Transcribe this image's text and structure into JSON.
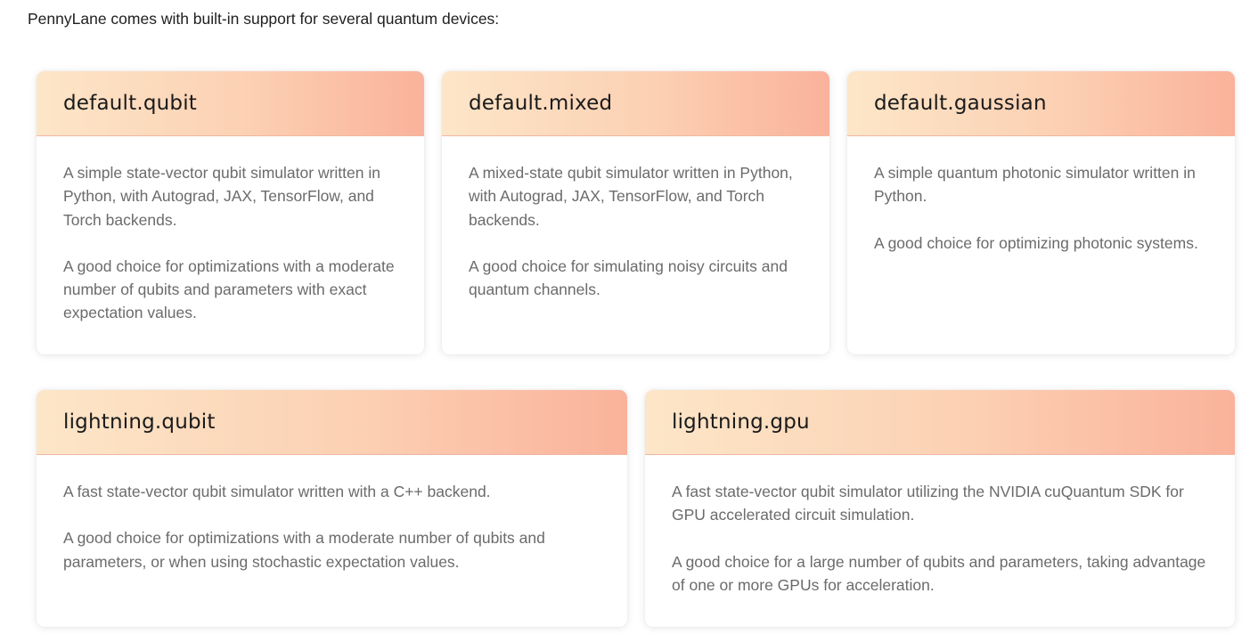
{
  "intro": "PennyLane comes with built-in support for several quantum devices:",
  "devices": [
    {
      "title": "default.qubit",
      "description": "A simple state-vector qubit simulator written in Python, with Autograd, JAX, TensorFlow, and Torch backends.",
      "use_case": "A good choice for optimizations with a moderate number of qubits and parameters with exact expectation values."
    },
    {
      "title": "default.mixed",
      "description": "A mixed-state qubit simulator written in Python, with Autograd, JAX, TensorFlow, and Torch backends.",
      "use_case": "A good choice for simulating noisy circuits and quantum channels."
    },
    {
      "title": "default.gaussian",
      "description": "A simple quantum photonic simulator written in Python.",
      "use_case": "A good choice for optimizing photonic systems."
    },
    {
      "title": "lightning.qubit",
      "description": "A fast state-vector qubit simulator written with a C++ backend.",
      "use_case": "A good choice for optimizations with a moderate number of qubits and parameters, or when using stochastic expectation values."
    },
    {
      "title": "lightning.gpu",
      "description": "A fast state-vector qubit simulator utilizing the NVIDIA cuQuantum SDK for GPU accelerated circuit simulation.",
      "use_case": "A good choice for a large number of qubits and parameters, taking advantage of one or more GPUs for acceleration."
    }
  ],
  "colors": {
    "header_gradient_start": "#fde6c8",
    "header_gradient_end": "#fab29b",
    "body_text": "#6b6b6b"
  }
}
